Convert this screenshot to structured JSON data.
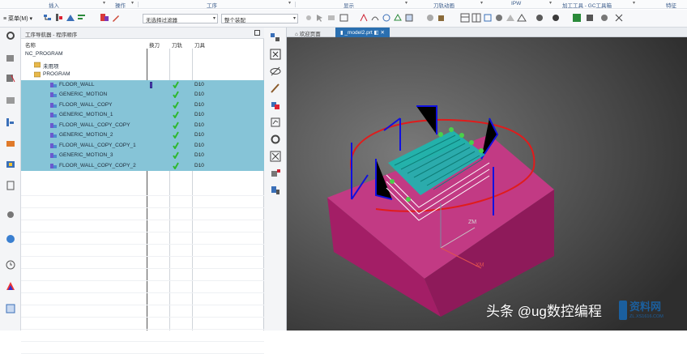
{
  "ribbon_groups": [
    "插入",
    "操作",
    "工序",
    "显示",
    "刀轨动画",
    "IPW",
    "加工工具 - GC工具箱",
    "特征"
  ],
  "toolbar": {
    "menu_label": "菜单(M)",
    "filter_select": "无选择过滤器",
    "assembly_select": "整个装配"
  },
  "navigator": {
    "title": "工序导航器 - 程序顺序",
    "columns": {
      "name": "名称",
      "tool_change": "换刀",
      "path": "刀轨",
      "tool": "刀具"
    },
    "rows": [
      {
        "name": "NC_PROGRAM",
        "level": 0,
        "type": "root",
        "selected": false,
        "tool": ""
      },
      {
        "name": "未用项",
        "level": 1,
        "type": "folder",
        "selected": false,
        "tool": ""
      },
      {
        "name": "PROGRAM",
        "level": 1,
        "type": "program",
        "selected": false,
        "tool": ""
      },
      {
        "name": "FLOOR_WALL",
        "level": 2,
        "type": "op",
        "selected": true,
        "tool": "D10",
        "tool_change": true,
        "path_ok": true
      },
      {
        "name": "GENERIC_MOTION",
        "level": 2,
        "type": "op",
        "selected": true,
        "tool": "D10",
        "path_ok": true
      },
      {
        "name": "FLOOR_WALL_COPY",
        "level": 2,
        "type": "op",
        "selected": true,
        "tool": "D10",
        "path_ok": true
      },
      {
        "name": "GENERIC_MOTION_1",
        "level": 2,
        "type": "op",
        "selected": true,
        "tool": "D10",
        "path_ok": true
      },
      {
        "name": "FLOOR_WALL_COPY_COPY",
        "level": 2,
        "type": "op",
        "selected": true,
        "tool": "D10",
        "path_ok": true
      },
      {
        "name": "GENERIC_MOTION_2",
        "level": 2,
        "type": "op",
        "selected": true,
        "tool": "D10",
        "path_ok": true
      },
      {
        "name": "FLOOR_WALL_COPY_COPY_1",
        "level": 2,
        "type": "op",
        "selected": true,
        "tool": "D10",
        "path_ok": true
      },
      {
        "name": "GENERIC_MOTION_3",
        "level": 2,
        "type": "op",
        "selected": true,
        "tool": "D10",
        "path_ok": true
      },
      {
        "name": "FLOOR_WALL_COPY_COPY_2",
        "level": 2,
        "type": "op",
        "selected": true,
        "tool": "D10",
        "path_ok": true
      }
    ]
  },
  "tabs": [
    {
      "label": "欢迎页面",
      "active": false
    },
    {
      "label": "_model2.prt",
      "active": true
    }
  ],
  "viewport": {
    "axis_labels": {
      "x": "XM",
      "z": "ZM"
    },
    "colors": {
      "block": "#b4296f",
      "toolpath": "#1bb8b0",
      "arc": "#e01c1c",
      "vectors": "#1010e0"
    }
  },
  "watermark": {
    "text": "头条 @ug数控编程",
    "logo": "资料网",
    "logo_url": "ZL.XS1616.COM"
  },
  "colors": {
    "selection": "#86c4d7",
    "active_tab": "#2a6fb0",
    "check": "#30b830"
  },
  "icons": [
    "settings-icon",
    "assembly-icon",
    "constraint-icon",
    "part-icon",
    "history-icon",
    "machine-icon",
    "geometry-icon",
    "method-icon",
    "gear-icon",
    "clock-icon",
    "palette-icon",
    "web-icon"
  ]
}
